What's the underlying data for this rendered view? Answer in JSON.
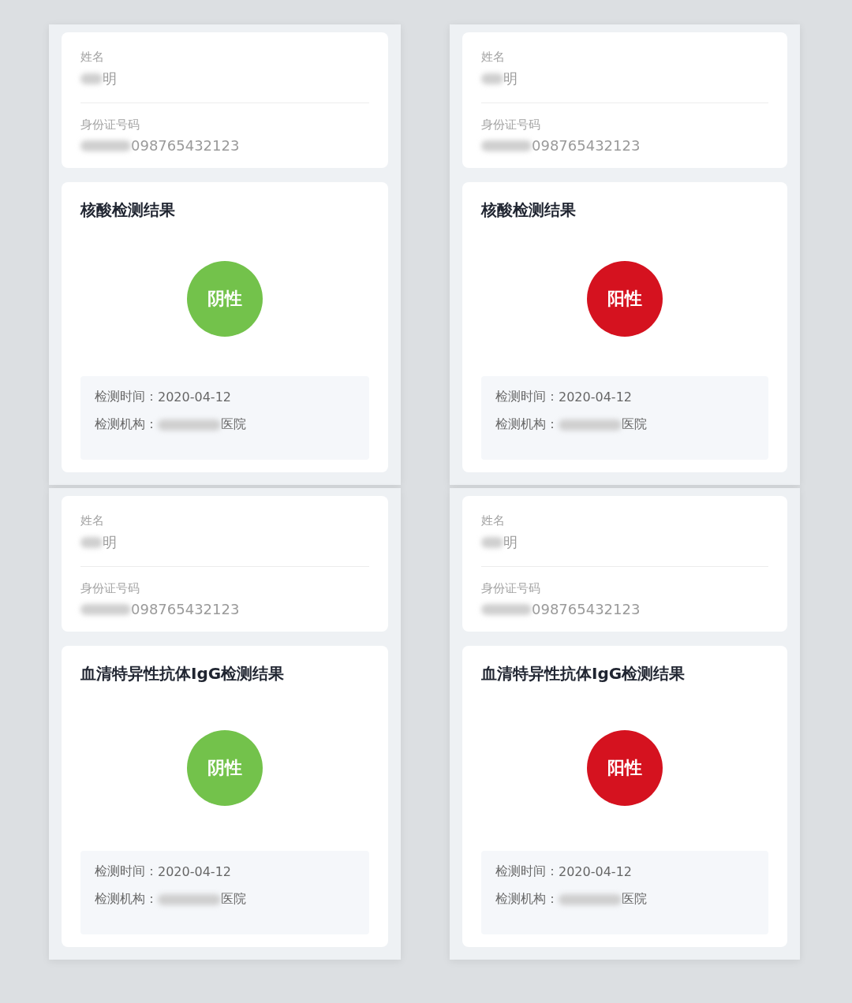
{
  "screens": [
    {
      "name_label": "姓名",
      "name_value": "明",
      "id_label": "身份证号码",
      "id_value": "098765432123",
      "result_title": "核酸检测结果",
      "result": {
        "text": "阴性",
        "kind": "negative"
      },
      "time_label": "检测时间：",
      "time_value": "2020-04-12",
      "org_label": "检测机构：",
      "org_value": "医院"
    },
    {
      "name_label": "姓名",
      "name_value": "明",
      "id_label": "身份证号码",
      "id_value": "098765432123",
      "result_title": "核酸检测结果",
      "result": {
        "text": "阳性",
        "kind": "positive"
      },
      "time_label": "检测时间：",
      "time_value": "2020-04-12",
      "org_label": "检测机构：",
      "org_value": "医院"
    },
    {
      "name_label": "姓名",
      "name_value": "明",
      "id_label": "身份证号码",
      "id_value": "098765432123",
      "result_title": "血清特异性抗体IgG检测结果",
      "result": {
        "text": "阴性",
        "kind": "negative"
      },
      "time_label": "检测时间：",
      "time_value": "2020-04-12",
      "org_label": "检测机构：",
      "org_value": "医院"
    },
    {
      "name_label": "姓名",
      "name_value": "明",
      "id_label": "身份证号码",
      "id_value": "098765432123",
      "result_title": "血清特异性抗体IgG检测结果",
      "result": {
        "text": "阳性",
        "kind": "positive"
      },
      "time_label": "检测时间：",
      "time_value": "2020-04-12",
      "org_label": "检测机构：",
      "org_value": "医院"
    }
  ]
}
